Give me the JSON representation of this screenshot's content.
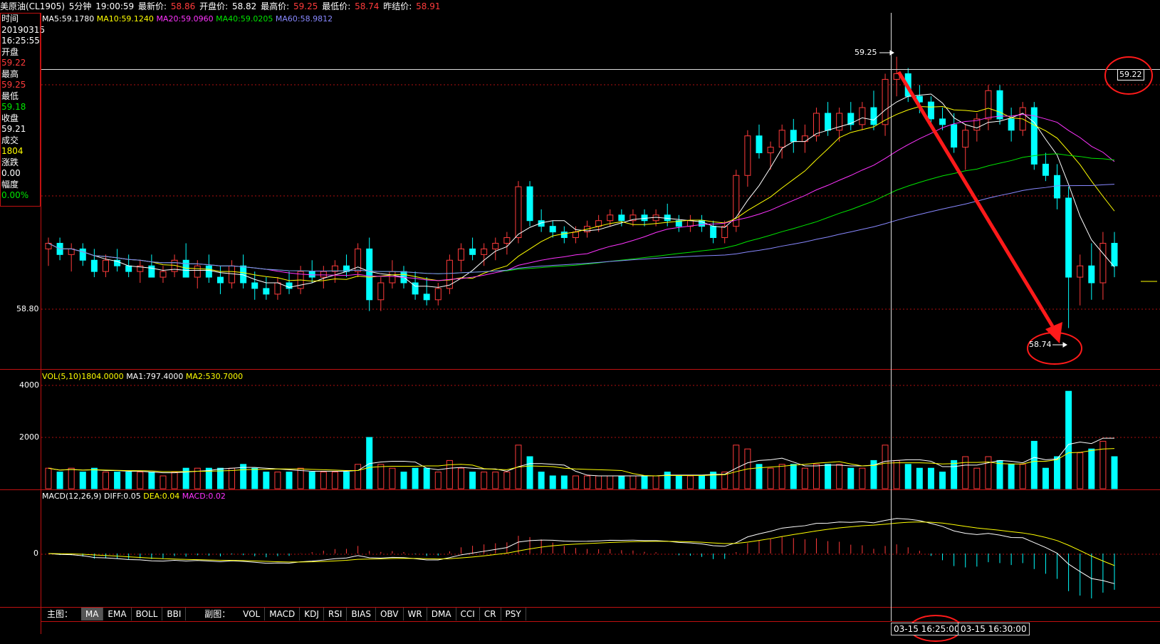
{
  "header": {
    "title": "美原油(CL1905)",
    "period": "5分钟",
    "time": "19:00:59",
    "latest_label": "最新价:",
    "latest_value": "58.86",
    "open_label": "开盘价:",
    "open_value": "58.82",
    "high_label": "最高价:",
    "high_value": "59.25",
    "low_label": "最低价:",
    "low_value": "58.74",
    "prev_label": "昨结价:",
    "prev_value": "58.91"
  },
  "sidebar": {
    "time_label": "时间",
    "date": "20190315",
    "time": "16:25:55",
    "open_label": "开盘",
    "open": "59.22",
    "high_label": "最高",
    "high": "59.25",
    "low_label": "最低",
    "low": "59.18",
    "close_label": "收盘",
    "close": "59.21",
    "volume_label": "成交",
    "volume": "1804",
    "change_label": "涨跌",
    "change": "0.00",
    "amp_label": "幅度",
    "amp": "0.00%"
  },
  "ma_legend": {
    "ma5": "MA5:59.1780",
    "ma10": "MA10:59.1240",
    "ma20": "MA20:59.0960",
    "ma40": "MA40:59.0205",
    "ma60": "MA60:58.9812"
  },
  "vol_legend": {
    "vol": "VOL(5,10)1804.0000",
    "ma1": "MA1:797.4000",
    "ma2": "MA2:530.7000"
  },
  "macd_legend": {
    "name": "MACD(12,26,9)",
    "diff": "DIFF:0.05",
    "dea": "DEA:0.04",
    "macd": "MACD:0.02"
  },
  "annotations": {
    "high_marker": "59.25",
    "low_marker": "58.74",
    "cursor_price": "59.22",
    "price_axis_label": "58.80",
    "vol_axis_4000": "4000",
    "vol_axis_2000": "2000",
    "macd_axis_0": "0"
  },
  "toolbar": {
    "main_label": "主图：",
    "main_items": [
      "MA",
      "EMA",
      "BOLL",
      "BBI"
    ],
    "sub_label": "副图：",
    "sub_items": [
      "VOL",
      "MACD",
      "KDJ",
      "RSI",
      "BIAS",
      "OBV",
      "WR",
      "DMA",
      "CCI",
      "CR",
      "PSY"
    ]
  },
  "time_boxes": {
    "cursor": "03-15  16:25:00",
    "right": "03-15 16:30:00"
  },
  "colors": {
    "up": "#ff3b3b",
    "down": "#00ffff",
    "grid": "#c01010",
    "ma5": "#ffffff",
    "ma10": "#ffff00",
    "ma20": "#ff33ff",
    "ma40": "#00e600",
    "ma60": "#8888ff",
    "annotation": "#ff1a1a"
  },
  "chart_data": {
    "type": "candlestick",
    "price_range": [
      58.7,
      59.3
    ],
    "candles": [
      [
        58.91,
        58.93,
        58.88,
        58.92
      ],
      [
        58.92,
        58.93,
        58.89,
        58.9
      ],
      [
        58.9,
        58.92,
        58.87,
        58.91
      ],
      [
        58.91,
        58.92,
        58.88,
        58.89
      ],
      [
        58.89,
        58.91,
        58.86,
        58.87
      ],
      [
        58.87,
        58.9,
        58.86,
        58.89
      ],
      [
        58.89,
        58.91,
        58.87,
        58.88
      ],
      [
        58.88,
        58.9,
        58.86,
        58.87
      ],
      [
        58.87,
        58.89,
        58.85,
        58.88
      ],
      [
        58.88,
        58.9,
        58.86,
        58.86
      ],
      [
        58.86,
        58.88,
        58.85,
        58.87
      ],
      [
        58.87,
        58.9,
        58.86,
        58.89
      ],
      [
        58.89,
        58.92,
        58.87,
        58.86
      ],
      [
        58.86,
        58.89,
        58.84,
        58.88
      ],
      [
        58.88,
        58.9,
        58.85,
        58.86
      ],
      [
        58.86,
        58.88,
        58.83,
        58.85
      ],
      [
        58.85,
        58.89,
        58.84,
        58.88
      ],
      [
        58.88,
        58.9,
        58.84,
        58.85
      ],
      [
        58.85,
        58.87,
        58.82,
        58.84
      ],
      [
        58.84,
        58.86,
        58.82,
        58.83
      ],
      [
        58.83,
        58.86,
        58.82,
        58.85
      ],
      [
        58.85,
        58.87,
        58.83,
        58.84
      ],
      [
        58.84,
        58.88,
        58.83,
        58.87
      ],
      [
        58.87,
        58.89,
        58.85,
        58.86
      ],
      [
        58.86,
        58.88,
        58.84,
        58.87
      ],
      [
        58.87,
        58.89,
        58.85,
        58.88
      ],
      [
        58.88,
        58.9,
        58.86,
        58.87
      ],
      [
        58.87,
        58.92,
        58.86,
        58.91
      ],
      [
        58.91,
        58.93,
        58.8,
        58.82
      ],
      [
        58.82,
        58.86,
        58.8,
        58.85
      ],
      [
        58.85,
        58.89,
        58.84,
        58.87
      ],
      [
        58.87,
        58.88,
        58.84,
        58.85
      ],
      [
        58.85,
        58.87,
        58.82,
        58.83
      ],
      [
        58.83,
        58.86,
        58.81,
        58.82
      ],
      [
        58.82,
        58.85,
        58.81,
        58.84
      ],
      [
        58.84,
        58.9,
        58.83,
        58.89
      ],
      [
        58.89,
        58.92,
        58.87,
        58.91
      ],
      [
        58.91,
        58.93,
        58.89,
        58.9
      ],
      [
        58.9,
        58.92,
        58.88,
        58.91
      ],
      [
        58.91,
        58.93,
        58.89,
        58.92
      ],
      [
        58.92,
        58.94,
        58.9,
        58.93
      ],
      [
        58.93,
        59.03,
        58.92,
        59.02
      ],
      [
        59.02,
        59.03,
        58.95,
        58.96
      ],
      [
        58.96,
        58.98,
        58.94,
        58.95
      ],
      [
        58.95,
        58.96,
        58.93,
        58.94
      ],
      [
        58.94,
        58.95,
        58.92,
        58.93
      ],
      [
        58.93,
        58.95,
        58.92,
        58.94
      ],
      [
        58.94,
        58.96,
        58.93,
        58.95
      ],
      [
        58.95,
        58.97,
        58.94,
        58.96
      ],
      [
        58.96,
        58.98,
        58.95,
        58.97
      ],
      [
        58.97,
        58.98,
        58.95,
        58.96
      ],
      [
        58.96,
        58.98,
        58.95,
        58.97
      ],
      [
        58.97,
        58.98,
        58.95,
        58.96
      ],
      [
        58.96,
        58.98,
        58.95,
        58.97
      ],
      [
        58.97,
        58.99,
        58.95,
        58.96
      ],
      [
        58.96,
        58.97,
        58.94,
        58.95
      ],
      [
        58.95,
        58.97,
        58.94,
        58.96
      ],
      [
        58.96,
        58.97,
        58.94,
        58.95
      ],
      [
        58.95,
        58.96,
        58.92,
        58.93
      ],
      [
        58.93,
        58.96,
        58.92,
        58.95
      ],
      [
        58.95,
        59.05,
        58.94,
        59.04
      ],
      [
        59.04,
        59.12,
        59.02,
        59.11
      ],
      [
        59.11,
        59.13,
        59.07,
        59.08
      ],
      [
        59.08,
        59.1,
        59.05,
        59.09
      ],
      [
        59.09,
        59.13,
        59.07,
        59.12
      ],
      [
        59.12,
        59.14,
        59.08,
        59.1
      ],
      [
        59.1,
        59.13,
        59.08,
        59.11
      ],
      [
        59.11,
        59.16,
        59.1,
        59.15
      ],
      [
        59.15,
        59.17,
        59.11,
        59.12
      ],
      [
        59.12,
        59.16,
        59.1,
        59.15
      ],
      [
        59.15,
        59.17,
        59.12,
        59.13
      ],
      [
        59.13,
        59.17,
        59.12,
        59.16
      ],
      [
        59.16,
        59.19,
        59.12,
        59.13
      ],
      [
        59.13,
        59.22,
        59.11,
        59.21
      ],
      [
        59.21,
        59.25,
        59.18,
        59.22
      ],
      [
        59.22,
        59.23,
        59.17,
        59.18
      ],
      [
        59.18,
        59.2,
        59.15,
        59.17
      ],
      [
        59.17,
        59.18,
        59.13,
        59.14
      ],
      [
        59.14,
        59.16,
        59.12,
        59.13
      ],
      [
        59.13,
        59.15,
        59.08,
        59.09
      ],
      [
        59.09,
        59.13,
        59.05,
        59.12
      ],
      [
        59.12,
        59.15,
        59.1,
        59.14
      ],
      [
        59.14,
        59.2,
        59.12,
        59.19
      ],
      [
        59.19,
        59.2,
        59.13,
        59.14
      ],
      [
        59.14,
        59.16,
        59.1,
        59.12
      ],
      [
        59.12,
        59.17,
        59.11,
        59.16
      ],
      [
        59.16,
        59.17,
        59.05,
        59.06
      ],
      [
        59.06,
        59.08,
        59.03,
        59.04
      ],
      [
        59.04,
        59.06,
        58.98,
        59.0
      ],
      [
        59.0,
        59.02,
        58.77,
        58.86
      ],
      [
        58.86,
        58.9,
        58.81,
        58.88
      ],
      [
        58.88,
        58.92,
        58.82,
        58.85
      ],
      [
        58.85,
        58.94,
        58.82,
        58.92
      ],
      [
        58.92,
        58.94,
        58.86,
        58.88
      ]
    ]
  }
}
